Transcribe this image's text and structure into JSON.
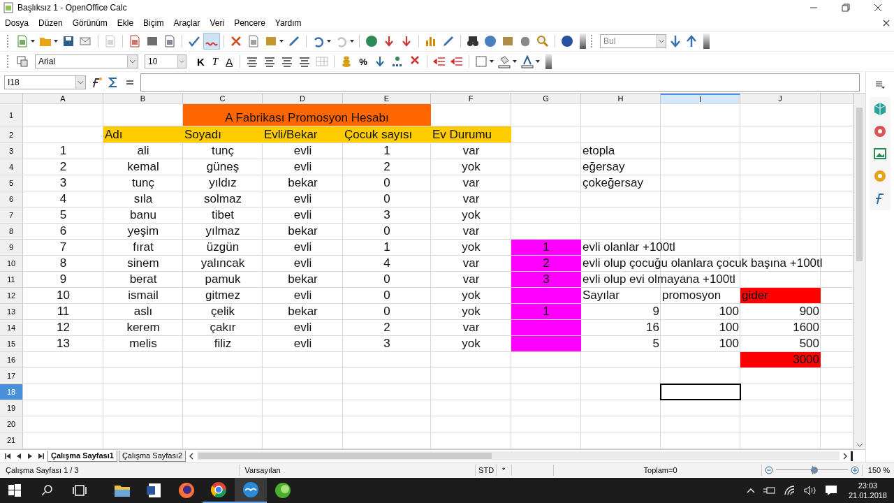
{
  "window": {
    "title": "Başlıksız 1 - OpenOffice Calc"
  },
  "menu": [
    "Dosya",
    "Düzen",
    "Görünüm",
    "Ekle",
    "Biçim",
    "Araçlar",
    "Veri",
    "Pencere",
    "Yardım"
  ],
  "find_toolbar": {
    "placeholder": "Bul"
  },
  "format_toolbar": {
    "font": "Arial",
    "size": "10",
    "style_buttons": [
      {
        "label": "K",
        "kind": "bold"
      },
      {
        "label": "T",
        "kind": "italic"
      },
      {
        "label": "A",
        "kind": "underline"
      }
    ],
    "percent": "%"
  },
  "formula_bar": {
    "name_box": "I18"
  },
  "sheet": {
    "columns": [
      {
        "label": "A",
        "selected": false
      },
      {
        "label": "B",
        "selected": false
      },
      {
        "label": "C",
        "selected": false
      },
      {
        "label": "D",
        "selected": false
      },
      {
        "label": "E",
        "selected": false
      },
      {
        "label": "F",
        "selected": false
      },
      {
        "label": "G",
        "selected": false
      },
      {
        "label": "H",
        "selected": false
      },
      {
        "label": "I",
        "selected": true
      },
      {
        "label": "J",
        "selected": false
      }
    ],
    "rows": [
      {
        "label": "1",
        "selected": false,
        "cells": [
          {},
          {},
          {
            "text": "A Fabrikası Promosyon Hesabı",
            "color": "#ff6600"
          },
          {},
          {},
          {},
          {},
          {}
        ]
      },
      {
        "label": "2",
        "selected": false,
        "cells": [
          {},
          {
            "text": "Adı",
            "color": "#ffcc00"
          },
          {
            "text": "Soyadı",
            "color": "#ffcc00"
          },
          {
            "text": "Evli/Bekar",
            "color": "#ffcc00"
          },
          {
            "text": "Çocuk sayısı",
            "color": "#ffcc00"
          },
          {
            "text": "Ev Durumu",
            "color": "#ffcc00"
          },
          {},
          {},
          {},
          {}
        ]
      },
      {
        "label": "3",
        "selected": false,
        "cells": [
          {
            "text": "1"
          },
          {
            "text": "ali"
          },
          {
            "text": "tunç"
          },
          {
            "text": "evli"
          },
          {
            "text": "1"
          },
          {
            "text": "var"
          },
          {},
          {
            "text": "etopla"
          },
          {},
          {}
        ]
      },
      {
        "label": "4",
        "selected": false,
        "cells": [
          {
            "text": "2"
          },
          {
            "text": "kemal"
          },
          {
            "text": "güneş"
          },
          {
            "text": "evli"
          },
          {
            "text": "2"
          },
          {
            "text": "yok"
          },
          {},
          {
            "text": "eğersay"
          },
          {},
          {}
        ]
      },
      {
        "label": "5",
        "selected": false,
        "cells": [
          {
            "text": "3"
          },
          {
            "text": "tunç"
          },
          {
            "text": "yıldız"
          },
          {
            "text": "bekar"
          },
          {
            "text": "0"
          },
          {
            "text": "var"
          },
          {},
          {
            "text": "çokeğersay"
          },
          {},
          {}
        ]
      },
      {
        "label": "6",
        "selected": false,
        "cells": [
          {
            "text": "4"
          },
          {
            "text": "sıla"
          },
          {
            "text": "solmaz"
          },
          {
            "text": "evli"
          },
          {
            "text": "0"
          },
          {
            "text": "var"
          },
          {},
          {},
          {},
          {}
        ]
      },
      {
        "label": "7",
        "selected": false,
        "cells": [
          {
            "text": "5"
          },
          {
            "text": "banu"
          },
          {
            "text": "tibet"
          },
          {
            "text": "evli"
          },
          {
            "text": "3"
          },
          {
            "text": "yok"
          },
          {},
          {},
          {},
          {}
        ]
      },
      {
        "label": "8",
        "selected": false,
        "cells": [
          {
            "text": "6"
          },
          {
            "text": "yeşim"
          },
          {
            "text": "yılmaz"
          },
          {
            "text": "bekar"
          },
          {
            "text": "0"
          },
          {
            "text": "var"
          },
          {},
          {},
          {},
          {}
        ]
      },
      {
        "label": "9",
        "selected": false,
        "cells": [
          {
            "text": "7"
          },
          {
            "text": "fırat"
          },
          {
            "text": "üzgün"
          },
          {
            "text": "evli"
          },
          {
            "text": "1"
          },
          {
            "text": "yok"
          },
          {
            "text": "1",
            "color": "#ff00ff"
          },
          {
            "text": "evli olanlar +100tl"
          },
          {},
          {}
        ]
      },
      {
        "label": "10",
        "selected": false,
        "cells": [
          {
            "text": "8"
          },
          {
            "text": "sinem"
          },
          {
            "text": "yalıncak"
          },
          {
            "text": "evli"
          },
          {
            "text": "4"
          },
          {
            "text": "var"
          },
          {
            "text": "2",
            "color": "#ff00ff"
          },
          {
            "text": "evli olup çocuğu olanlara çocuk başına +100tl"
          },
          {},
          {}
        ]
      },
      {
        "label": "11",
        "selected": false,
        "cells": [
          {
            "text": "9"
          },
          {
            "text": "berat"
          },
          {
            "text": "pamuk"
          },
          {
            "text": "bekar"
          },
          {
            "text": "0"
          },
          {
            "text": "var"
          },
          {
            "text": "3",
            "color": "#ff00ff"
          },
          {
            "text": "evli olup evi olmayana +100tl"
          },
          {},
          {}
        ]
      },
      {
        "label": "12",
        "selected": false,
        "cells": [
          {
            "text": "10"
          },
          {
            "text": "ismail"
          },
          {
            "text": "gitmez"
          },
          {
            "text": "evli"
          },
          {
            "text": "0"
          },
          {
            "text": "yok"
          },
          {
            "color": "#ff00ff"
          },
          {
            "text": "Sayılar"
          },
          {
            "text": "promosyon"
          },
          {
            "text": "gider",
            "color": "#ff0000"
          }
        ]
      },
      {
        "label": "13",
        "selected": false,
        "cells": [
          {
            "text": "11"
          },
          {
            "text": "aslı"
          },
          {
            "text": "çelik"
          },
          {
            "text": "bekar"
          },
          {
            "text": "0"
          },
          {
            "text": "yok"
          },
          {
            "text": "1",
            "color": "#ff00ff"
          },
          {
            "text": "9",
            "kind": "number"
          },
          {
            "text": "100",
            "kind": "number"
          },
          {
            "text": "900",
            "kind": "number"
          }
        ]
      },
      {
        "label": "14",
        "selected": false,
        "cells": [
          {
            "text": "12"
          },
          {
            "text": "kerem"
          },
          {
            "text": "çakır"
          },
          {
            "text": "evli"
          },
          {
            "text": "2"
          },
          {
            "text": "var"
          },
          {
            "color": "#ff00ff"
          },
          {
            "text": "16",
            "kind": "number"
          },
          {
            "text": "100",
            "kind": "number"
          },
          {
            "text": "1600",
            "kind": "number"
          }
        ]
      },
      {
        "label": "15",
        "selected": false,
        "cells": [
          {
            "text": "13"
          },
          {
            "text": "melis"
          },
          {
            "text": "filiz"
          },
          {
            "text": "evli"
          },
          {
            "text": "3"
          },
          {
            "text": "yok"
          },
          {
            "color": "#ff00ff"
          },
          {
            "text": "5",
            "kind": "number"
          },
          {
            "text": "100",
            "kind": "number"
          },
          {
            "text": "500",
            "kind": "number"
          }
        ]
      },
      {
        "label": "16",
        "selected": false,
        "cells": [
          {},
          {},
          {},
          {},
          {},
          {},
          {},
          {},
          {},
          {
            "text": "3000",
            "kind": "number",
            "color": "#ff0000"
          }
        ]
      },
      {
        "label": "17",
        "selected": false
      },
      {
        "label": "18",
        "selected": true
      },
      {
        "label": "19",
        "selected": false
      },
      {
        "label": "20",
        "selected": false
      },
      {
        "label": "21",
        "selected": false
      }
    ]
  },
  "sheet_tabs": [
    {
      "label": "Çalışma Sayfası1",
      "selected": true
    },
    {
      "label": "Çalışma Sayfası2",
      "selected": false
    }
  ],
  "status_bar": {
    "sheet": "Çalışma Sayfası 1 / 3",
    "page_style": "Varsayılan",
    "mode": "STD",
    "modified": "*",
    "sum": "Toplam=0",
    "zoom": {
      "level": 0.53,
      "reading": "150 %"
    }
  },
  "taskbar": {
    "apps": [
      {
        "open": false,
        "selected": false
      },
      {
        "open": false,
        "selected": false
      },
      {
        "open": false,
        "selected": false
      },
      {
        "open": true,
        "selected": false
      },
      {
        "open": true,
        "selected": true
      },
      {
        "open": false,
        "selected": false
      }
    ],
    "time": "23:03",
    "date": "21.01.2018"
  }
}
